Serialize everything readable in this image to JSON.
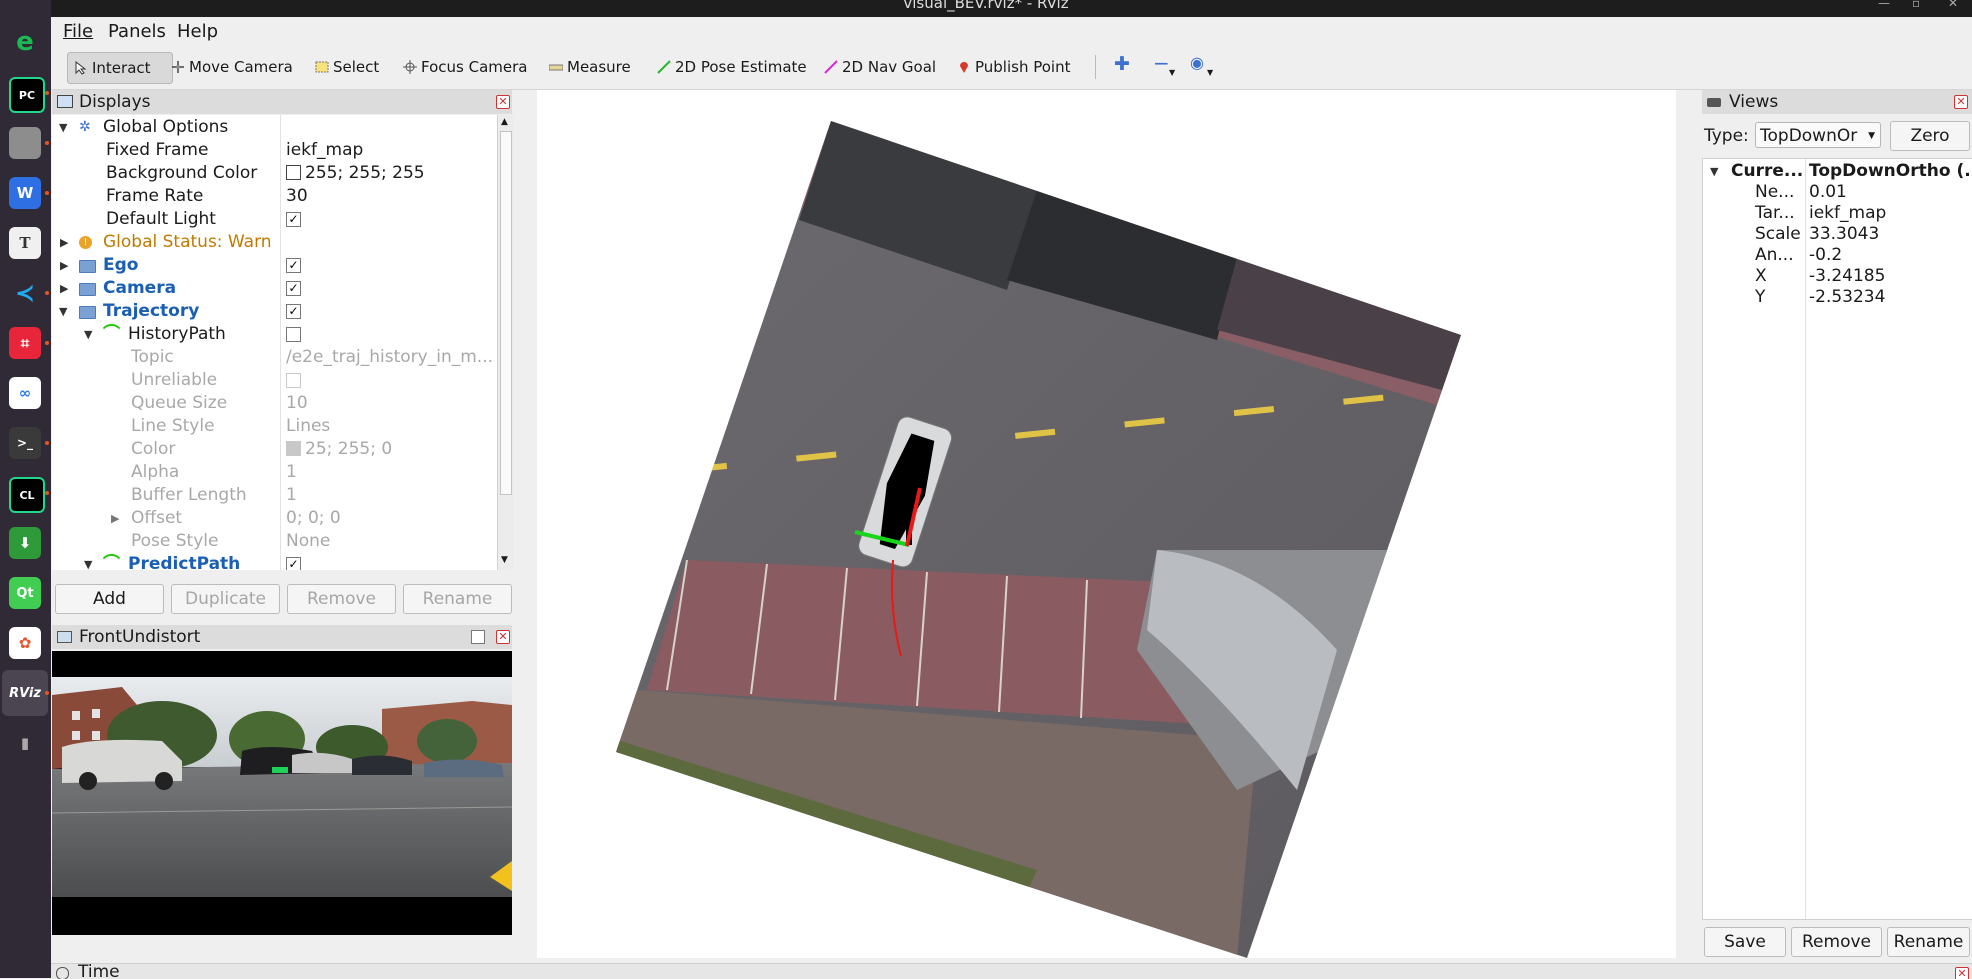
{
  "window": {
    "title": "visual_BEV.rviz* - RViz"
  },
  "menu": {
    "file": "File",
    "panels": "Panels",
    "help": "Help"
  },
  "toolbar": {
    "tools": [
      {
        "label": "Interact",
        "icon": "cursor-icon",
        "active": true
      },
      {
        "label": "Move Camera",
        "icon": "move-camera-icon"
      },
      {
        "label": "Select",
        "icon": "select-icon"
      },
      {
        "label": "Focus Camera",
        "icon": "focus-camera-icon"
      },
      {
        "label": "Measure",
        "icon": "measure-icon"
      },
      {
        "label": "2D Pose Estimate",
        "icon": "pose-estimate-icon"
      },
      {
        "label": "2D Nav Goal",
        "icon": "nav-goal-icon"
      },
      {
        "label": "Publish Point",
        "icon": "publish-point-icon"
      }
    ]
  },
  "displays": {
    "title": "Displays",
    "global_options": "Global Options",
    "fixed_frame": {
      "label": "Fixed Frame",
      "value": "iekf_map"
    },
    "background_color": {
      "label": "Background Color",
      "value": "255; 255; 255"
    },
    "frame_rate": {
      "label": "Frame Rate",
      "value": "30"
    },
    "default_light": {
      "label": "Default Light",
      "checked": "✓"
    },
    "global_status": "Global Status: Warn",
    "ego": {
      "label": "Ego",
      "checked": "✓"
    },
    "camera": {
      "label": "Camera",
      "checked": "✓"
    },
    "trajectory": {
      "label": "Trajectory",
      "checked": "✓"
    },
    "history_path": {
      "label": "HistoryPath",
      "topic": {
        "label": "Topic",
        "value": "/e2e_traj_history_in_m..."
      },
      "unreliable": {
        "label": "Unreliable"
      },
      "queue_size": {
        "label": "Queue Size",
        "value": "10"
      },
      "line_style": {
        "label": "Line Style",
        "value": "Lines"
      },
      "color": {
        "label": "Color",
        "value": "25; 255; 0"
      },
      "alpha": {
        "label": "Alpha",
        "value": "1"
      },
      "buffer_length": {
        "label": "Buffer Length",
        "value": "1"
      },
      "offset": {
        "label": "Offset",
        "value": "0; 0; 0"
      },
      "pose_style": {
        "label": "Pose Style",
        "value": "None"
      }
    },
    "predict_path": {
      "label": "PredictPath",
      "checked": "✓"
    },
    "buttons": {
      "add": "Add",
      "duplicate": "Duplicate",
      "remove": "Remove",
      "rename": "Rename"
    }
  },
  "image_panel": {
    "title": "FrontUndistort"
  },
  "views": {
    "title": "Views",
    "type_label": "Type:",
    "type_value": "TopDownOr",
    "zero": "Zero",
    "current": {
      "label": "Curre...",
      "value": "TopDownOrtho (..."
    },
    "props": [
      {
        "label": "Ne...",
        "value": "0.01"
      },
      {
        "label": "Tar...",
        "value": "iekf_map"
      },
      {
        "label": "Scale",
        "value": "33.3043"
      },
      {
        "label": "An...",
        "value": "-0.2"
      },
      {
        "label": "X",
        "value": "-3.24185"
      },
      {
        "label": "Y",
        "value": "-2.53234"
      }
    ],
    "buttons": {
      "save": "Save",
      "remove": "Remove",
      "rename": "Rename"
    }
  },
  "time_panel": {
    "title": "Time"
  },
  "colors": {
    "history_path_line": "#19ff00",
    "warn": "#c07a00",
    "display_blue": "#1a5fb4"
  }
}
